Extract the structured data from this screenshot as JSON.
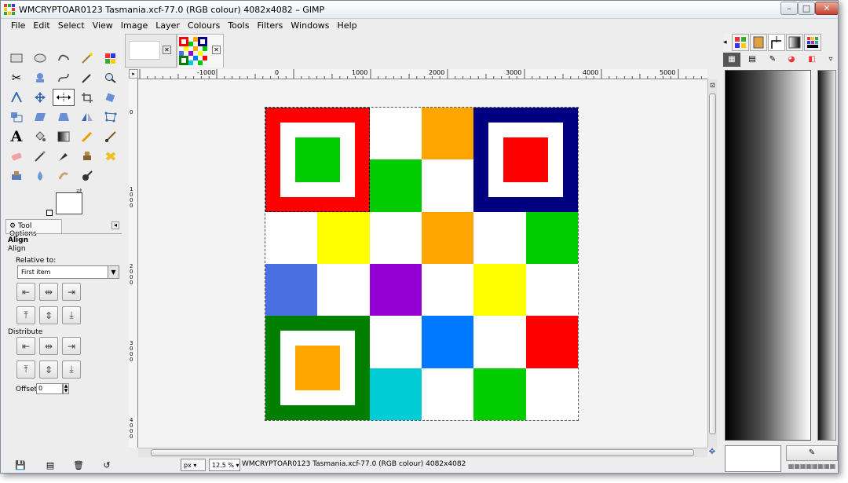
{
  "window": {
    "title": "WMCRYPTOAR0123 Tasmania.xcf-77.0 (RGB colour) 4082x4082 – GIMP",
    "minimize": "–",
    "maximize": "□",
    "close": "✕"
  },
  "menubar": [
    "File",
    "Edit",
    "Select",
    "View",
    "Image",
    "Layer",
    "Colours",
    "Tools",
    "Filters",
    "Windows",
    "Help"
  ],
  "tool_options": {
    "tab_label": "Tool Options",
    "tool_name": "Align",
    "tool_sub": "Align",
    "relative_to_label": "Relative to:",
    "relative_to_value": "First item",
    "distribute_label": "Distribute",
    "offset_label": "Offset:",
    "offset_value": "0"
  },
  "rulers": {
    "horizontal": [
      "-1000",
      "0",
      "1000",
      "2000",
      "3000",
      "4000",
      "5000"
    ],
    "vertical": [
      "0",
      "1000",
      "2000",
      "3000",
      "4000"
    ]
  },
  "statusbar": {
    "unit": "px",
    "zoom": "12.5 %",
    "text": "WMCRYPTOAR0123 Tasmania.xcf-77.0 (RGB colour) 4082x4082"
  },
  "image_grid": {
    "colors": {
      "red": "#ff0000",
      "green": "#00cc00",
      "orange": "#ffa500",
      "navy": "#000080",
      "yellow": "#ffff00",
      "blue": "#4a6fe0",
      "purple": "#9400d3",
      "azure": "#0078ff",
      "dark_green": "#007f00",
      "cyan": "#00cdd5",
      "white": "#ffffff"
    },
    "cells": [
      [
        "red",
        "red",
        "white",
        "orange",
        "navy",
        "navy"
      ],
      [
        "red",
        "red",
        "green",
        "white",
        "navy",
        "navy"
      ],
      [
        "white",
        "yellow",
        "white",
        "orange",
        "white",
        "green"
      ],
      [
        "blue",
        "white",
        "purple",
        "white",
        "yellow",
        "white"
      ],
      [
        "dark_green",
        "dark_green",
        "white",
        "azure",
        "white",
        "red"
      ],
      [
        "dark_green",
        "dark_green",
        "cyan",
        "white",
        "green",
        "white"
      ]
    ]
  },
  "dock": {
    "edit_label": "✎"
  }
}
